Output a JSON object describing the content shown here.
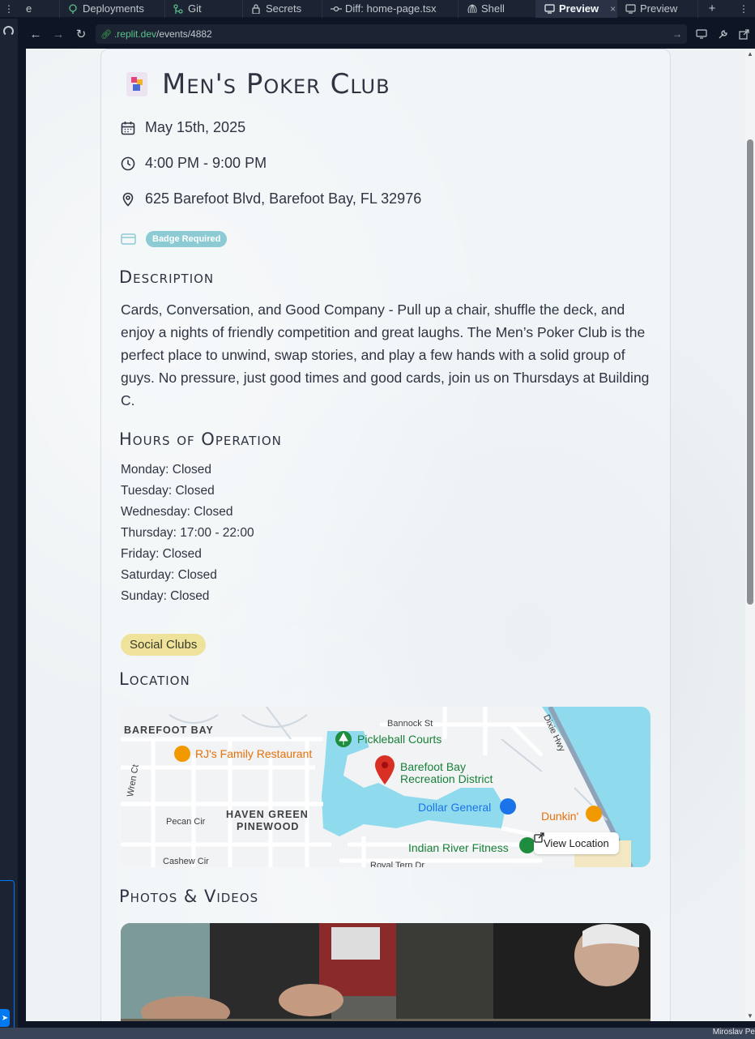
{
  "tabs": [
    {
      "label": "e",
      "icon": "none"
    },
    {
      "label": "Deployments",
      "icon": "deploy-icon"
    },
    {
      "label": "Git",
      "icon": "git-icon"
    },
    {
      "label": "Secrets",
      "icon": "lock-icon"
    },
    {
      "label": "Diff: home-page.tsx",
      "icon": "commit-icon"
    },
    {
      "label": "Shell",
      "icon": "shell-icon"
    },
    {
      "label": "Preview",
      "icon": "monitor-icon",
      "active": true,
      "close": "×"
    },
    {
      "label": "Preview",
      "icon": "monitor-icon"
    }
  ],
  "tabbar": {
    "plus": "+",
    "menu": "⋮"
  },
  "url": {
    "host": ".replit.dev",
    "path": "/events/4882"
  },
  "event": {
    "title": "Men's Poker Club",
    "date": "May 15th, 2025",
    "time": "4:00 PM - 9:00 PM",
    "address": "625 Barefoot Blvd, Barefoot Bay, FL 32976",
    "badge": "Badge Required",
    "description_heading": "Description",
    "description": "Cards, Conversation, and Good Company - Pull up a chair, shuffle the deck, and enjoy a nights of friendly competition and great laughs. The Men’s Poker Club is the perfect place to unwind, swap stories, and play a few hands with a solid group of guys. No pressure, just good times and good cards, join us on Thursdays at Building C.",
    "hours_heading": "Hours of Operation",
    "hours": [
      "Monday: Closed",
      "Tuesday: Closed",
      "Wednesday: Closed",
      "Thursday: 17:00 - 22:00",
      "Friday: Closed",
      "Saturday: Closed",
      "Sunday: Closed"
    ],
    "category_tag": "Social Clubs",
    "location_heading": "Location",
    "photos_heading": "Photos & Videos"
  },
  "map": {
    "labels": {
      "barefoot_bay": "BAREFOOT BAY",
      "haven_green": "HAVEN GREEN",
      "pinewood": "PINEWOOD",
      "rjs": "RJ's Family Restaurant",
      "pickleball": "Pickleball Courts",
      "rec_district_1": "Barefoot Bay",
      "rec_district_2": "Recreation District",
      "dollar_general": "Dollar General",
      "dunkin": "Dunkin'",
      "indian_river": "Indian River Fitness",
      "bannock": "Bannock St",
      "pecan": "Pecan Cir",
      "cashew": "Cashew Cir",
      "wren": "Wren Ct",
      "dixie": "Dixie Hwy",
      "royal_tern": "Royal Tern Dr"
    },
    "view_location": "View Location"
  },
  "status": {
    "user": "Miroslav Pe"
  },
  "colors": {
    "accent_badge": "#8ccad4",
    "tag": "#efe39b",
    "pin": "#d93025"
  }
}
